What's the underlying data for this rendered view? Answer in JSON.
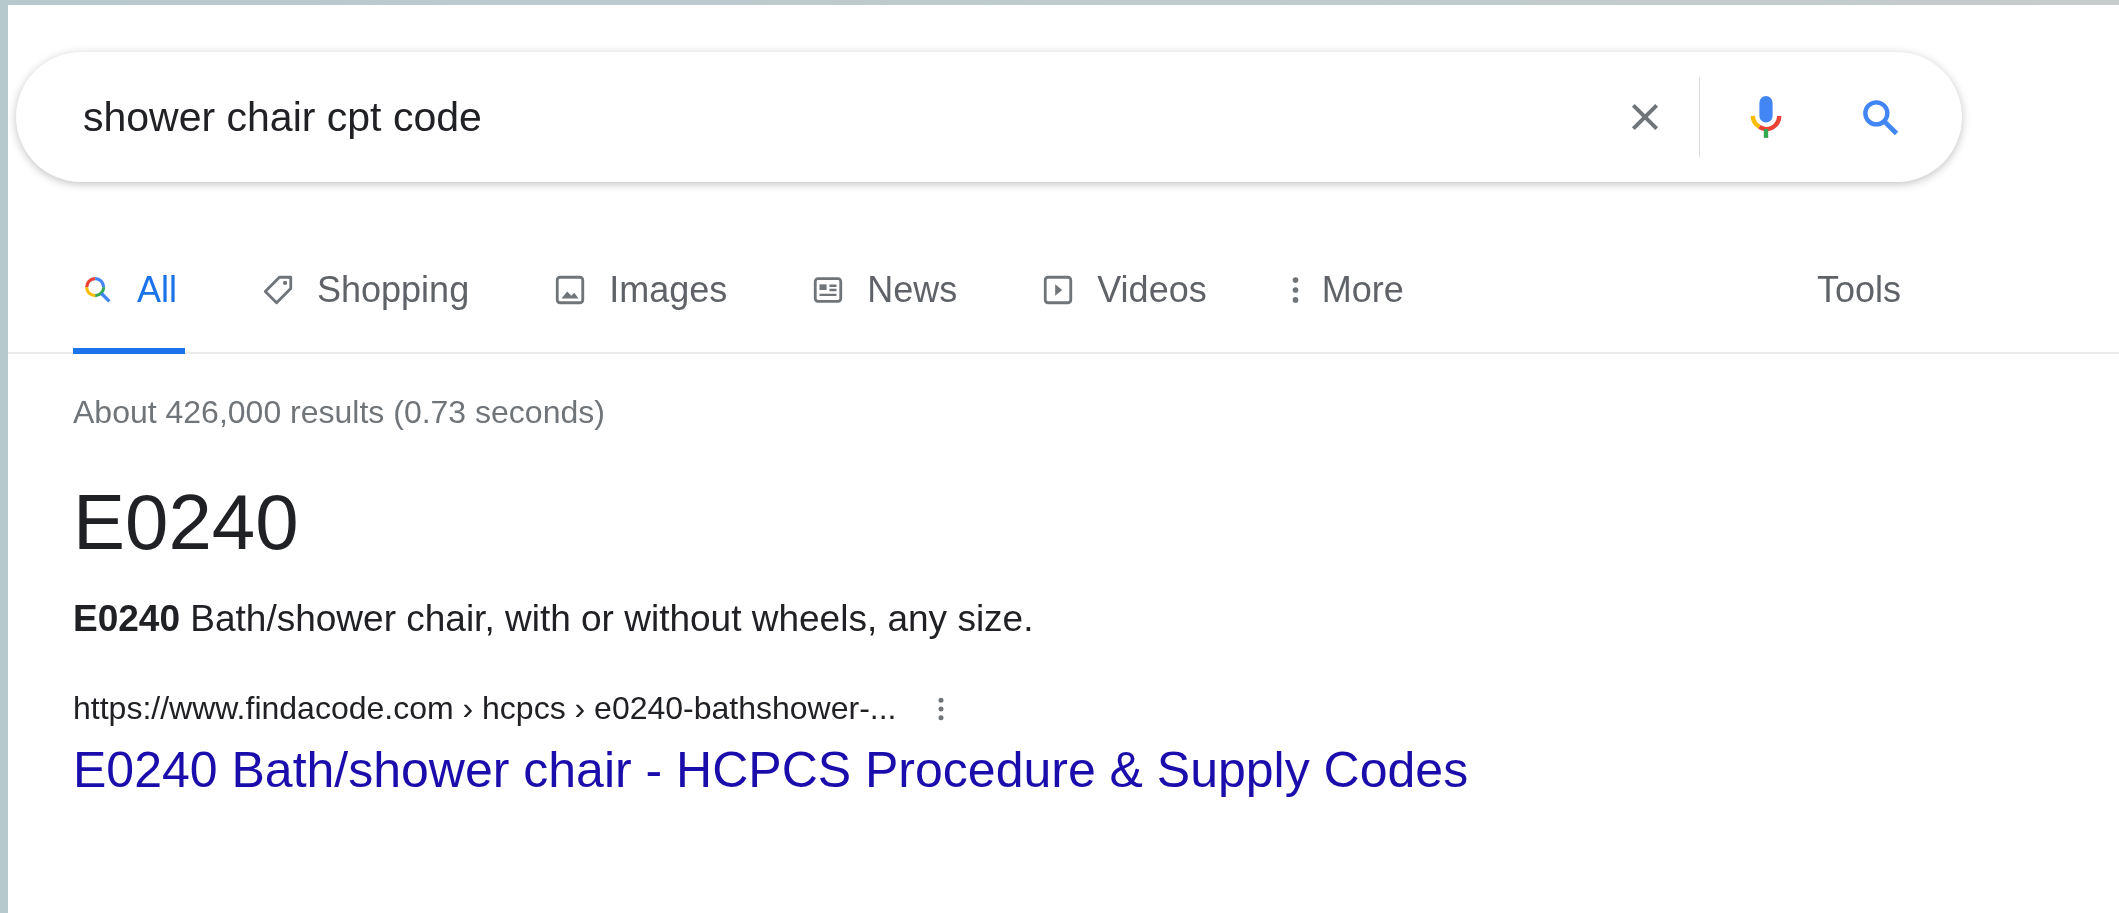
{
  "search": {
    "value": "shower chair cpt code"
  },
  "tabs": [
    {
      "label": "All",
      "kind": "search",
      "selected": true
    },
    {
      "label": "Shopping",
      "kind": "tag",
      "selected": false
    },
    {
      "label": "Images",
      "kind": "image",
      "selected": false
    },
    {
      "label": "News",
      "kind": "news",
      "selected": false
    },
    {
      "label": "Videos",
      "kind": "video",
      "selected": false
    },
    {
      "label": "More",
      "kind": "dots",
      "selected": false
    }
  ],
  "tools": "Tools",
  "result_stats": "About 426,000 results (0.73 seconds)",
  "featured": {
    "heading": "E0240",
    "snippet": "**E0240** Bath/shower chair, with or without wheels, any size.",
    "url": "https://www.findacode.com › hcpcs › e0240-bathshower-...",
    "title": "E0240 Bath/shower chair - HCPCS Procedure & Supply Codes"
  }
}
